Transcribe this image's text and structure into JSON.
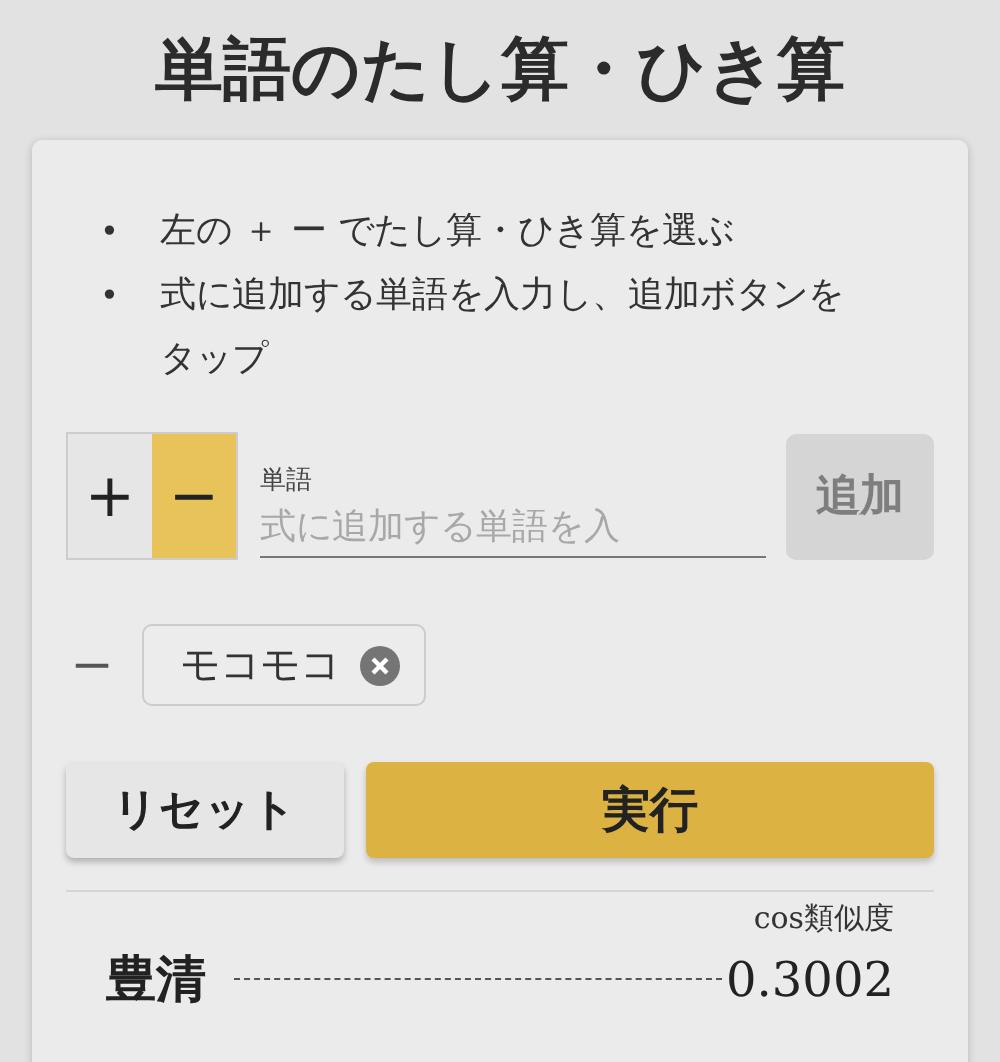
{
  "title": "単語のたし算・ひき算",
  "instructions": [
    {
      "marker": "•",
      "text": "左の ＋ ー でたし算・ひき算を選ぶ"
    },
    {
      "marker": "•",
      "text": "式に追加する単語を入力し、追加ボタンをタップ"
    }
  ],
  "operators": [
    {
      "label": "+",
      "selected": false
    },
    {
      "label": "−",
      "selected": true
    }
  ],
  "word_field": {
    "label": "単語",
    "placeholder": "式に追加する単語を入"
  },
  "add_button": {
    "label": "追加",
    "disabled": true
  },
  "terms": [
    {
      "sign": "−",
      "word": "モコモコ"
    }
  ],
  "reset_button": "リセット",
  "run_button": "実行",
  "results": {
    "header": "cos類似度",
    "rows": [
      {
        "word": "豊清",
        "score": "0.3002"
      }
    ]
  }
}
